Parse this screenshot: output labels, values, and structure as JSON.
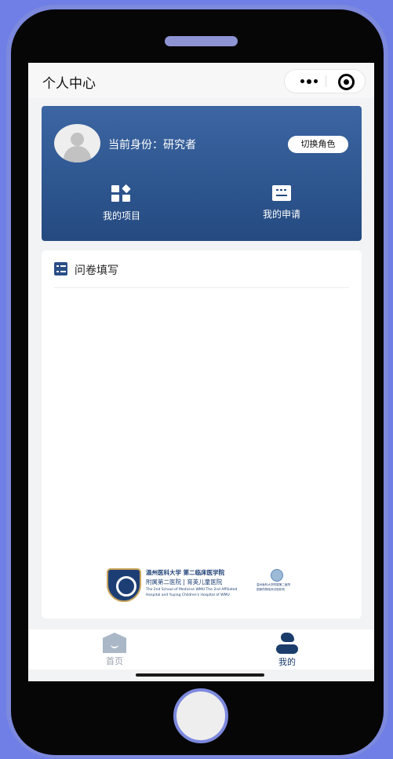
{
  "navbar": {
    "title": "个人中心",
    "more_icon": "more-dots-icon",
    "close_icon": "target-icon"
  },
  "profile": {
    "identity": "当前身份：研究者",
    "switch_label": "切换角色",
    "actions": [
      {
        "label": "我的项目",
        "icon": "grid-icon"
      },
      {
        "label": "我的申请",
        "icon": "document-icon"
      }
    ]
  },
  "questionnaire": {
    "title": "问卷填写",
    "icon": "checklist-icon"
  },
  "logo": {
    "line1": "温州医科大学 第二临床医学院",
    "line2": "附属第二医院 | 育英儿童医院",
    "line3": "The 2nd School of Medicine WMU·The 2nd Affiliated",
    "line4": "Hospital and Yuying Children's Hospital of WMU",
    "side1": "温州医科大学附属第二医院",
    "side2": "国家药物临床试验机构"
  },
  "tabbar": {
    "home_label": "首页",
    "me_label": "我的",
    "active": "我的"
  },
  "colors": {
    "primary": "#244a80",
    "accent_frame": "#7c89dd",
    "background": "#f2f3f5"
  }
}
